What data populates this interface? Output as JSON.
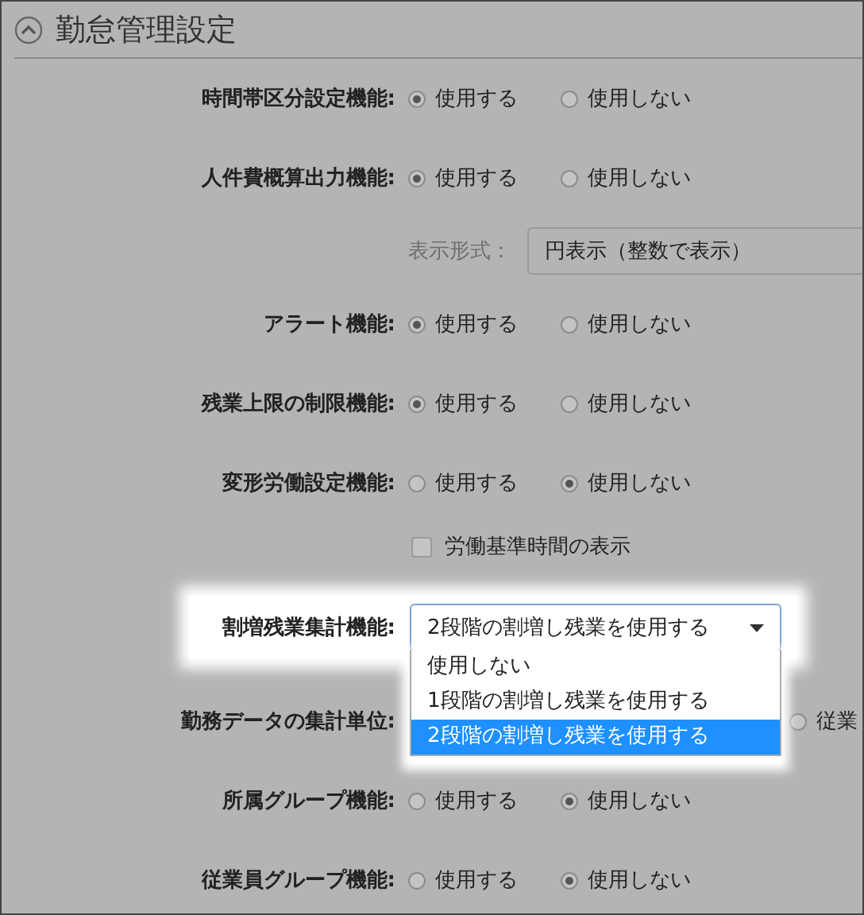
{
  "header": {
    "title": "勤怠管理設定",
    "expanded": true
  },
  "settings": [
    {
      "kind": "radio",
      "label": "時間帯区分設定機能:",
      "options": [
        {
          "label": "使用する",
          "selected": true
        },
        {
          "label": "使用しない",
          "selected": false
        }
      ]
    },
    {
      "kind": "radio",
      "label": "人件費概算出力機能:",
      "options": [
        {
          "label": "使用する",
          "selected": true
        },
        {
          "label": "使用しない",
          "selected": false
        }
      ]
    },
    {
      "kind": "select",
      "label": "表示形式：",
      "value": "円表示（整数で表示）"
    },
    {
      "kind": "radio",
      "label": "アラート機能:",
      "options": [
        {
          "label": "使用する",
          "selected": true
        },
        {
          "label": "使用しない",
          "selected": false
        }
      ]
    },
    {
      "kind": "radio",
      "label": "残業上限の制限機能:",
      "options": [
        {
          "label": "使用する",
          "selected": true
        },
        {
          "label": "使用しない",
          "selected": false
        }
      ]
    },
    {
      "kind": "radio",
      "label": "変形労働設定機能:",
      "options": [
        {
          "label": "使用する",
          "selected": false
        },
        {
          "label": "使用しない",
          "selected": true
        }
      ]
    },
    {
      "kind": "checkbox",
      "label": "労働基準時間の表示",
      "checked": false
    },
    {
      "kind": "dropdown",
      "label": "割増残業集計機能:",
      "value": "2段階の割増し残業を使用する",
      "options": [
        {
          "label": "使用しない",
          "selected": false
        },
        {
          "label": "1段階の割増し残業を使用する",
          "selected": false
        },
        {
          "label": "2段階の割増し残業を使用する",
          "selected": true
        }
      ]
    },
    {
      "kind": "radio-covered",
      "label": "勤務データの集計単位:",
      "options": [
        {
          "label": "従業",
          "selected": false
        }
      ]
    },
    {
      "kind": "radio",
      "label": "所属グループ機能:",
      "options": [
        {
          "label": "使用する",
          "selected": false
        },
        {
          "label": "使用しない",
          "selected": true
        }
      ]
    },
    {
      "kind": "radio",
      "label": "従業員グループ機能:",
      "options": [
        {
          "label": "使用する",
          "selected": false
        },
        {
          "label": "使用しない",
          "selected": true
        }
      ]
    }
  ]
}
